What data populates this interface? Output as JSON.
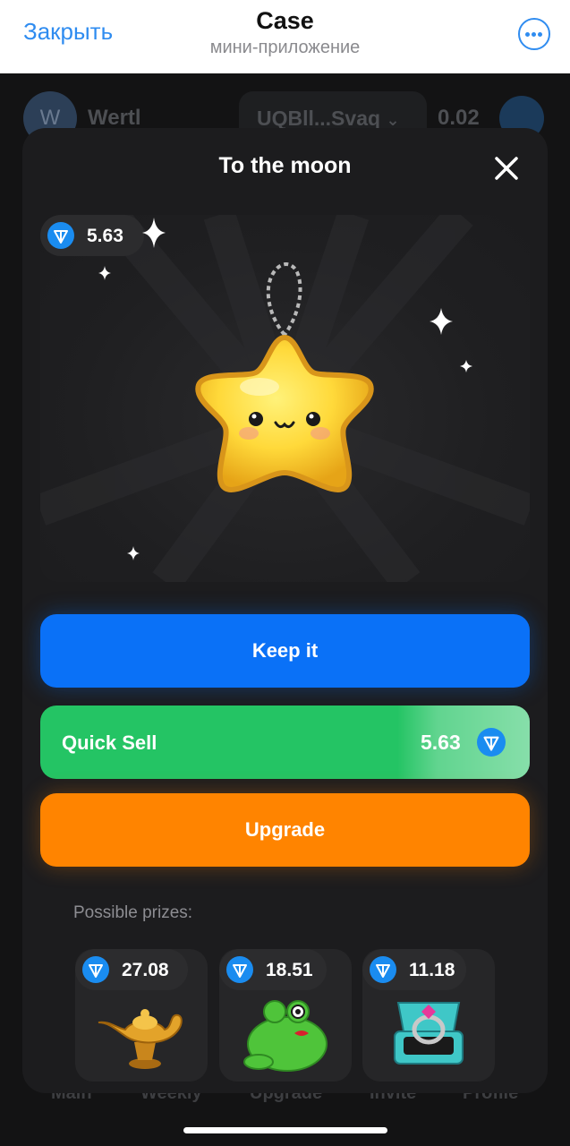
{
  "telegram": {
    "close_label": "Закрыть",
    "title": "Case",
    "subtitle": "мини-приложение",
    "more_icon": "more-horizontal-icon"
  },
  "background_app": {
    "avatar_letter": "W",
    "username": "Wertl",
    "wallet": "UQBll...Svaq",
    "balance": "0.02",
    "nav": [
      "Main",
      "Weekly",
      "Upgrade",
      "Invite",
      "Profile"
    ]
  },
  "modal": {
    "title": "To the moon",
    "prize_value": "5.63",
    "keep_label": "Keep it",
    "quick_sell_label": "Quick Sell",
    "quick_sell_price": "5.63",
    "upgrade_label": "Upgrade",
    "possible_prizes_label": "Possible prizes:",
    "possible_prizes": [
      {
        "value": "27.08",
        "item": "lamp"
      },
      {
        "value": "18.51",
        "item": "frog"
      },
      {
        "value": "11.18",
        "item": "ring"
      }
    ]
  },
  "colors": {
    "keep": "#0a71f7",
    "sell": "#24c464",
    "upgrade": "#ff8400",
    "ton": "#1a8cf0",
    "telegram_blue": "#2f8cf0"
  }
}
